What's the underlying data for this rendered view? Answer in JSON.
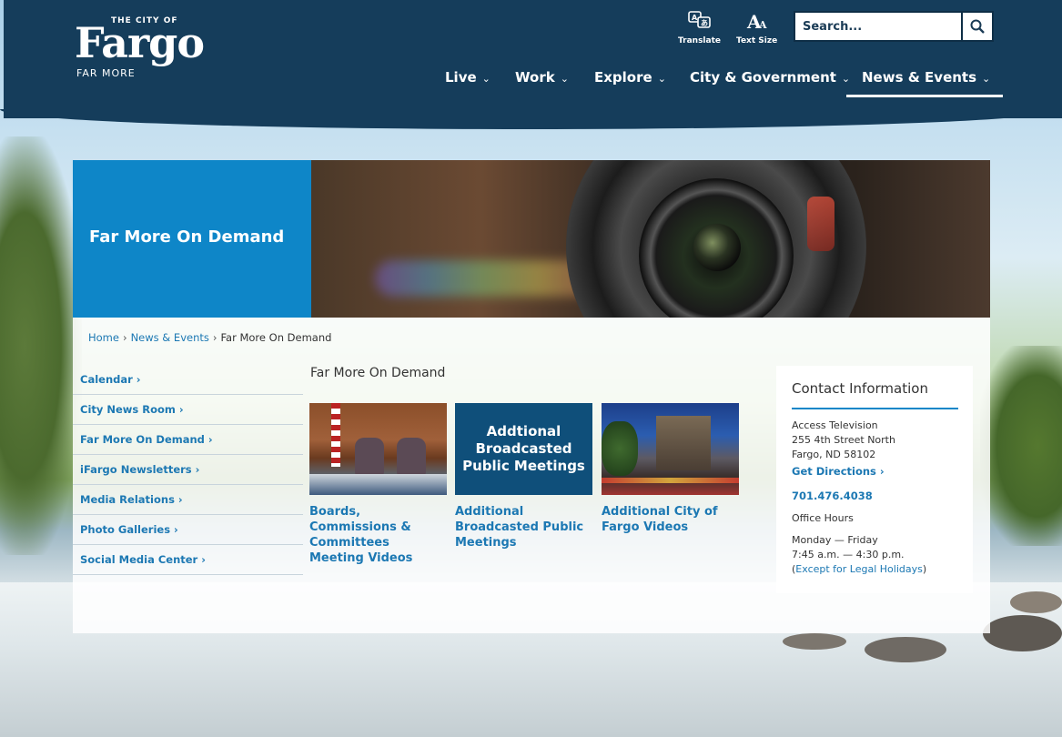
{
  "header": {
    "logo": {
      "top": "THE CITY OF",
      "main": "Fargo",
      "sub": "FAR MORE"
    },
    "translate_label": "Translate",
    "text_size_label": "Text Size",
    "search_placeholder": "Search...",
    "nav": [
      {
        "label": "Live"
      },
      {
        "label": "Work"
      },
      {
        "label": "Explore"
      },
      {
        "label": "City & Government"
      },
      {
        "label": "News & Events",
        "active": true
      }
    ],
    "chevron": "⌄"
  },
  "hero": {
    "title": "Far More On Demand"
  },
  "breadcrumb": {
    "home": "Home",
    "section": "News & Events",
    "current": "Far More On Demand",
    "separator": "›"
  },
  "sidenav": [
    "Calendar ›",
    "City News Room ›",
    "Far More On Demand ›",
    "iFargo Newsletters ›",
    "Media Relations ›",
    "Photo Galleries ›",
    "Social Media Center ›"
  ],
  "main": {
    "title": "Far More On Demand",
    "cards": [
      {
        "label": "Boards, Commissions & Committees Meeting Videos"
      },
      {
        "label": "Additional Broadcasted Public Meetings",
        "image_text": "Addtional Broadcasted Public Meetings"
      },
      {
        "label": "Additional City of Fargo Videos"
      }
    ]
  },
  "contact": {
    "title": "Contact Information",
    "org": "Access Television",
    "street": "255 4th Street North",
    "city": "Fargo, ND 58102",
    "directions": "Get Directions ›",
    "phone": "701.476.4038",
    "hours_label": "Office Hours",
    "days": "Monday — Friday",
    "hours": "7:45 a.m. — 4:30 p.m.",
    "paren_open": "(",
    "holidays": "Except for Legal Holidays",
    "paren_close": ")"
  },
  "colors": {
    "header": "#153d5b",
    "accent": "#0e86c8",
    "link": "#1c78b3"
  }
}
